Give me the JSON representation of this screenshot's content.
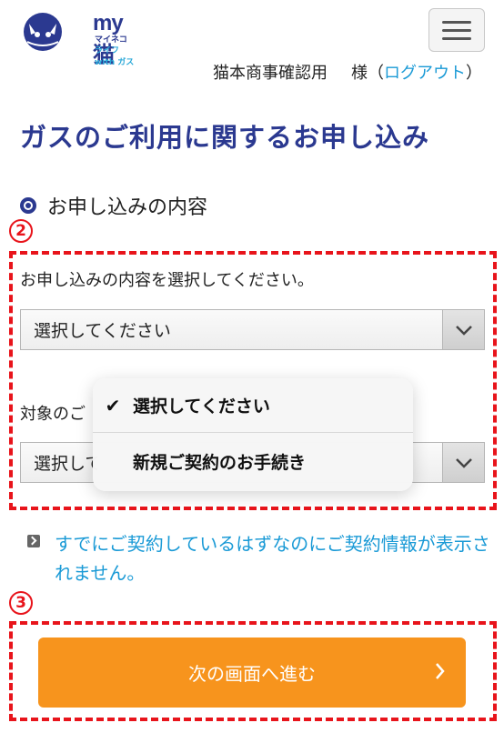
{
  "header": {
    "logo_main": "my猫",
    "logo_sub1": "マイネコ",
    "logo_sub2": "ライフ with ガス",
    "user_name": "猫本商事確認用",
    "honorific": "様（",
    "logout_label": "ログアウト",
    "close_paren": "）"
  },
  "page": {
    "title": "ガスのご利用に関するお申し込み",
    "section_heading": "お申し込みの内容"
  },
  "markers": {
    "form_area": "2",
    "button_area": "3"
  },
  "form": {
    "field1_label": "お申し込みの内容を選択してください。",
    "field1_value": "選択してください",
    "field2_label": "対象のご",
    "field2_value": "選択してください"
  },
  "dropdown": {
    "options": [
      {
        "label": "選択してください",
        "selected": true
      },
      {
        "label": "新規ご契約のお手続き",
        "selected": false
      }
    ]
  },
  "help": {
    "link_text": "すでにご契約しているはずなのにご契約情報が表示されません。"
  },
  "actions": {
    "next_label": "次の画面へ進む"
  },
  "colors": {
    "brand_navy": "#2b3990",
    "link_blue": "#1a9ad6",
    "button_orange": "#f7941d",
    "annotation_red": "#e8141b"
  }
}
